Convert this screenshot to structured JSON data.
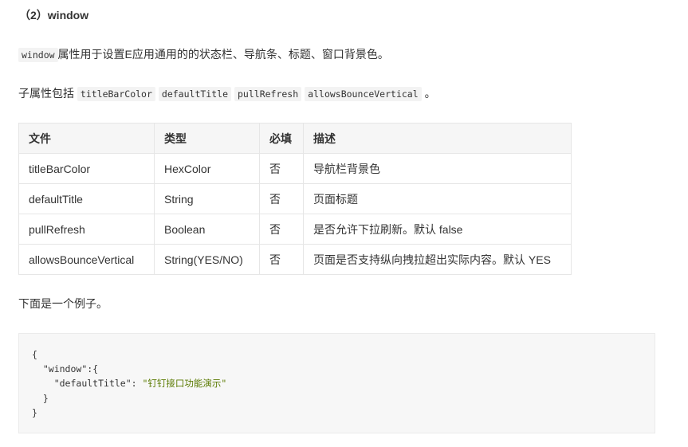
{
  "heading": "（2）window",
  "intro": {
    "code": "window",
    "text": "属性用于设置E应用通用的的状态栏、导航条、标题、窗口背景色。"
  },
  "subprops": {
    "prefix": "子属性包括",
    "items": [
      "titleBarColor",
      "defaultTitle",
      "pullRefresh",
      "allowsBounceVertical"
    ],
    "suffix": "。"
  },
  "table": {
    "headers": [
      "文件",
      "类型",
      "必填",
      "描述"
    ],
    "rows": [
      [
        "titleBarColor",
        "HexColor",
        "否",
        "导航栏背景色"
      ],
      [
        "defaultTitle",
        "String",
        "否",
        "页面标题"
      ],
      [
        "pullRefresh",
        "Boolean",
        "否",
        "是否允许下拉刷新。默认 false"
      ],
      [
        "allowsBounceVertical",
        "String(YES/NO)",
        "否",
        "页面是否支持纵向拽拉超出实际内容。默认 YES"
      ]
    ]
  },
  "example_intro": "下面是一个例子。",
  "code_example": {
    "l1": "{",
    "l2_key": "\"window\"",
    "l2_rest": ":{",
    "l3_key": "\"defaultTitle\"",
    "l3_sep": ": ",
    "l3_val": "\"钉钉接口功能演示\"",
    "l4": "}",
    "l5": "}"
  }
}
